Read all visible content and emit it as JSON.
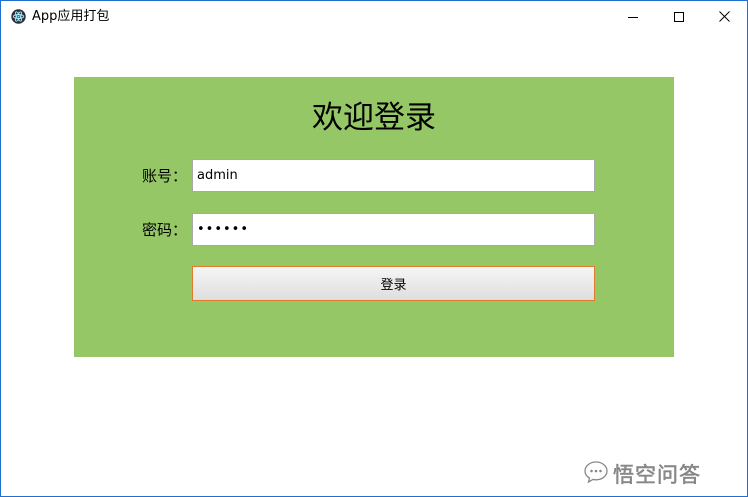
{
  "window": {
    "title": "App应用打包",
    "icon": "electron-atom-icon",
    "controls": {
      "minimize_icon": "minimize-icon",
      "maximize_icon": "maximize-icon",
      "close_icon": "close-icon"
    },
    "border_color": "#1e6fcf"
  },
  "login": {
    "panel_color": "#95c766",
    "title": "欢迎登录",
    "username_label": "账号：",
    "username_value": "admin",
    "password_label": "密码：",
    "password_value": "123456",
    "submit_label": "登录",
    "submit_border_color": "#e07c2b"
  },
  "watermark": {
    "text": "悟空问答",
    "icon": "chat-bubble-icon"
  }
}
